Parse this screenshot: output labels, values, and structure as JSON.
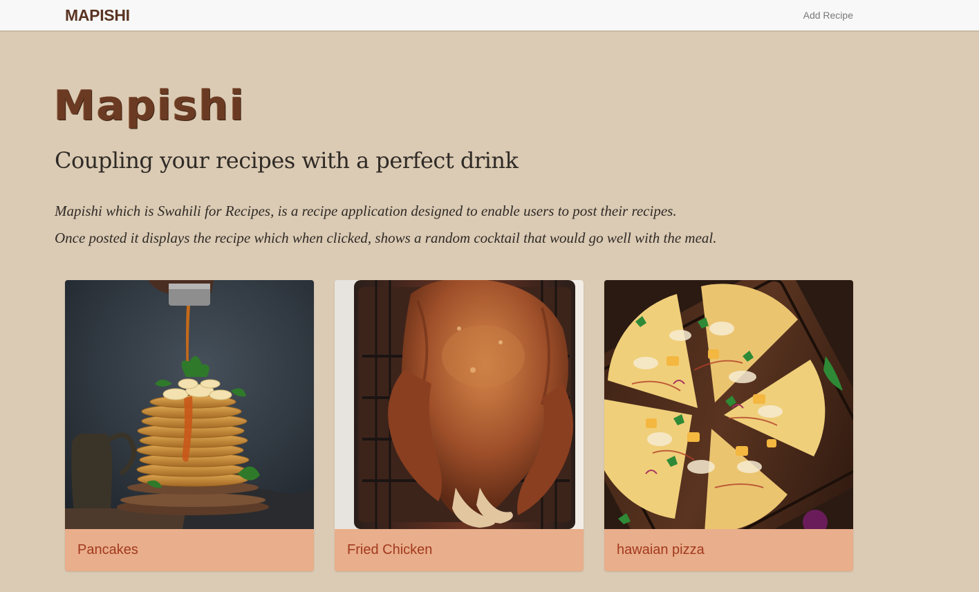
{
  "navbar": {
    "brand": "MAPISHI",
    "add_recipe_label": "Add Recipe"
  },
  "hero": {
    "title": "Mapishi",
    "tagline": "Coupling your recipes with a perfect drink",
    "description_line1": "Mapishi which is Swahili for Recipes, is a recipe application designed to enable users to post their recipes.",
    "description_line2": "Once posted it displays the recipe which when clicked, shows a random cocktail that would go well with the meal."
  },
  "recipes": [
    {
      "name": "Pancakes",
      "image": "pancake-stack-photo"
    },
    {
      "name": "Fried Chicken",
      "image": "roast-chicken-photo"
    },
    {
      "name": "hawaian pizza",
      "image": "pizza-photo"
    }
  ],
  "colors": {
    "page_background": "#dbcbb4",
    "navbar_background": "#f8f8f8",
    "brand": "#5a3422",
    "card_footer": "#e9ae8b",
    "card_label": "#a2391e"
  }
}
